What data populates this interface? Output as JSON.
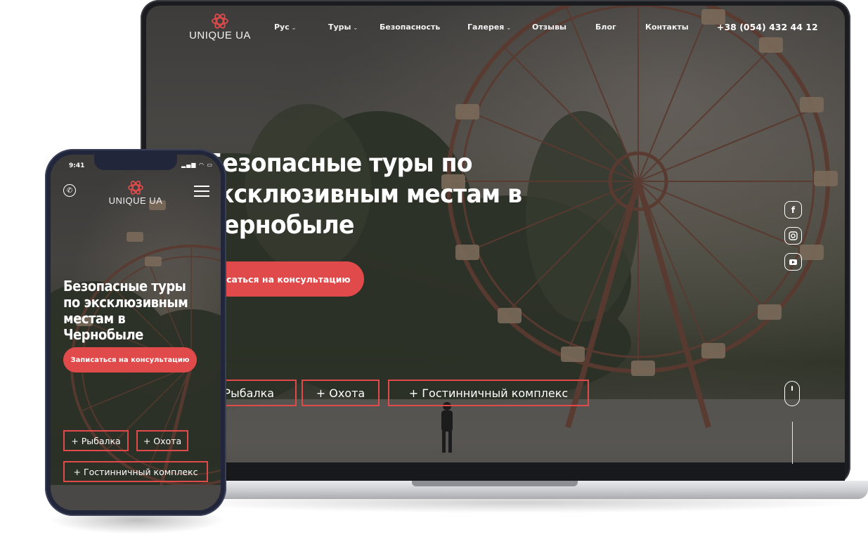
{
  "brand": {
    "name": "UNIQUE UA"
  },
  "colors": {
    "accent": "#e04a4b",
    "device_frame": "#1b1c20",
    "phone_frame": "#22263a"
  },
  "desktop": {
    "nav": [
      "Рус",
      "Туры",
      "Безопасность",
      "Галерея",
      "Отзывы",
      "Блог",
      "Контакты"
    ],
    "nav_dropdowns": [
      "Рус",
      "Туры",
      "Галерея"
    ],
    "phone": "+38 (054) 432 44 12",
    "hero_title": "Безопасные туры по эксклюзивным местам в Чернобыле",
    "cta": "Записаться на консультацию",
    "tags": [
      "+ Рыбалка",
      "+ Охота",
      "+ Гостинничный комплекс"
    ],
    "social": [
      "facebook-icon",
      "instagram-icon",
      "youtube-icon"
    ]
  },
  "mobile": {
    "status_time": "9:41",
    "hero_title": "Безопасные туры по эксклюзивным местам в Чернобыле",
    "cta": "Записаться на консультацию",
    "tags": [
      "+ Рыбалка",
      "+ Охота",
      "+ Гостинничный комплекс"
    ]
  }
}
